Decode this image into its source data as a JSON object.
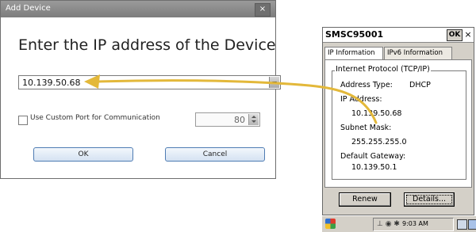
{
  "dialog": {
    "title": "Add Device",
    "close_glyph": "×",
    "heading": "Enter the IP address of the Device",
    "ip_value": "10.139.50.68",
    "custom_port_label": "Use Custom Port for Communication",
    "port_value": "80",
    "ok_label": "OK",
    "cancel_label": "Cancel"
  },
  "device": {
    "title": "SMSC95001",
    "ok_label": "OK",
    "close_glyph": "×",
    "tabs": [
      "IP Information",
      "IPv6 Information"
    ],
    "group_title": "Internet Protocol (TCP/IP)",
    "address_type_label": "Address Type:",
    "address_type_value": "DHCP",
    "ip_label": "IP Address:",
    "ip_value": "10.139.50.68",
    "subnet_label": "Subnet Mask:",
    "subnet_value": "255.255.255.0",
    "gateway_label": "Default Gateway:",
    "gateway_value": "10.139.50.1",
    "renew_label": "Renew",
    "details_label": "Details...",
    "clock": "9:03 AM",
    "tray_icons": "⊥ ◉ ✱",
    "start_icon": "windows-flag-icon"
  },
  "colors": {
    "arrow": "#e3b83a",
    "button_border": "#4f7cb3"
  }
}
